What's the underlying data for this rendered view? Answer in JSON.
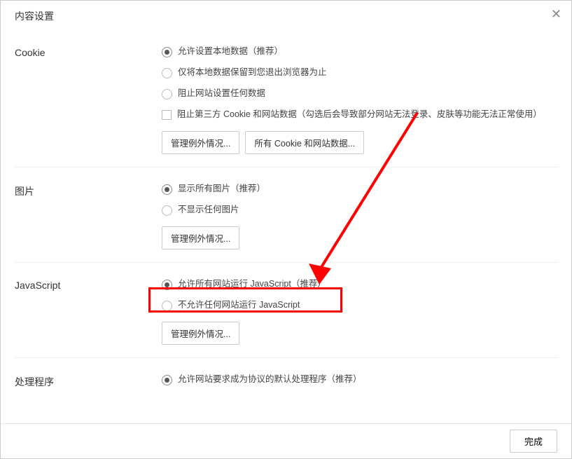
{
  "modal": {
    "title": "内容设置",
    "done_label": "完成"
  },
  "cookie": {
    "label": "Cookie",
    "opt1": "允许设置本地数据（推荐）",
    "opt2": "仅将本地数据保留到您退出浏览器为止",
    "opt3": "阻止网站设置任何数据",
    "chk1": "阻止第三方 Cookie 和网站数据（勾选后会导致部分网站无法登录、皮肤等功能无法正常使用）",
    "btn_exceptions": "管理例外情况...",
    "btn_all": "所有 Cookie 和网站数据..."
  },
  "images": {
    "label": "图片",
    "opt1": "显示所有图片（推荐）",
    "opt2": "不显示任何图片",
    "btn_exceptions": "管理例外情况..."
  },
  "javascript": {
    "label": "JavaScript",
    "opt1": "允许所有网站运行 JavaScript（推荐）",
    "opt2": "不允许任何网站运行 JavaScript",
    "btn_exceptions": "管理例外情况..."
  },
  "handlers": {
    "label": "处理程序",
    "opt1": "允许网站要求成为协议的默认处理程序（推荐）"
  }
}
